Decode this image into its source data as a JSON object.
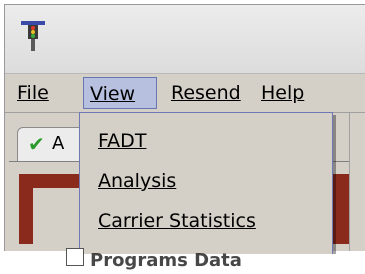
{
  "menubar": {
    "items": [
      {
        "label": "File"
      },
      {
        "label": "View"
      },
      {
        "label": "Resend"
      },
      {
        "label": "Help"
      }
    ]
  },
  "tab": {
    "label": "A"
  },
  "view_menu": {
    "items": [
      {
        "label": "FADT"
      },
      {
        "label": "Analysis"
      },
      {
        "label": "Carrier Statistics"
      }
    ]
  },
  "bottom": {
    "label": "Programs Data"
  },
  "colors": {
    "chrome": "#d4d0c8",
    "menu_highlight": "#b8c0e0",
    "menu_border": "#6f78b4",
    "frame_red": "#8a2a1c",
    "check_green": "#2a9a2a"
  },
  "icons": {
    "app": "traffic-light-icon",
    "tab_status": "check-icon"
  }
}
